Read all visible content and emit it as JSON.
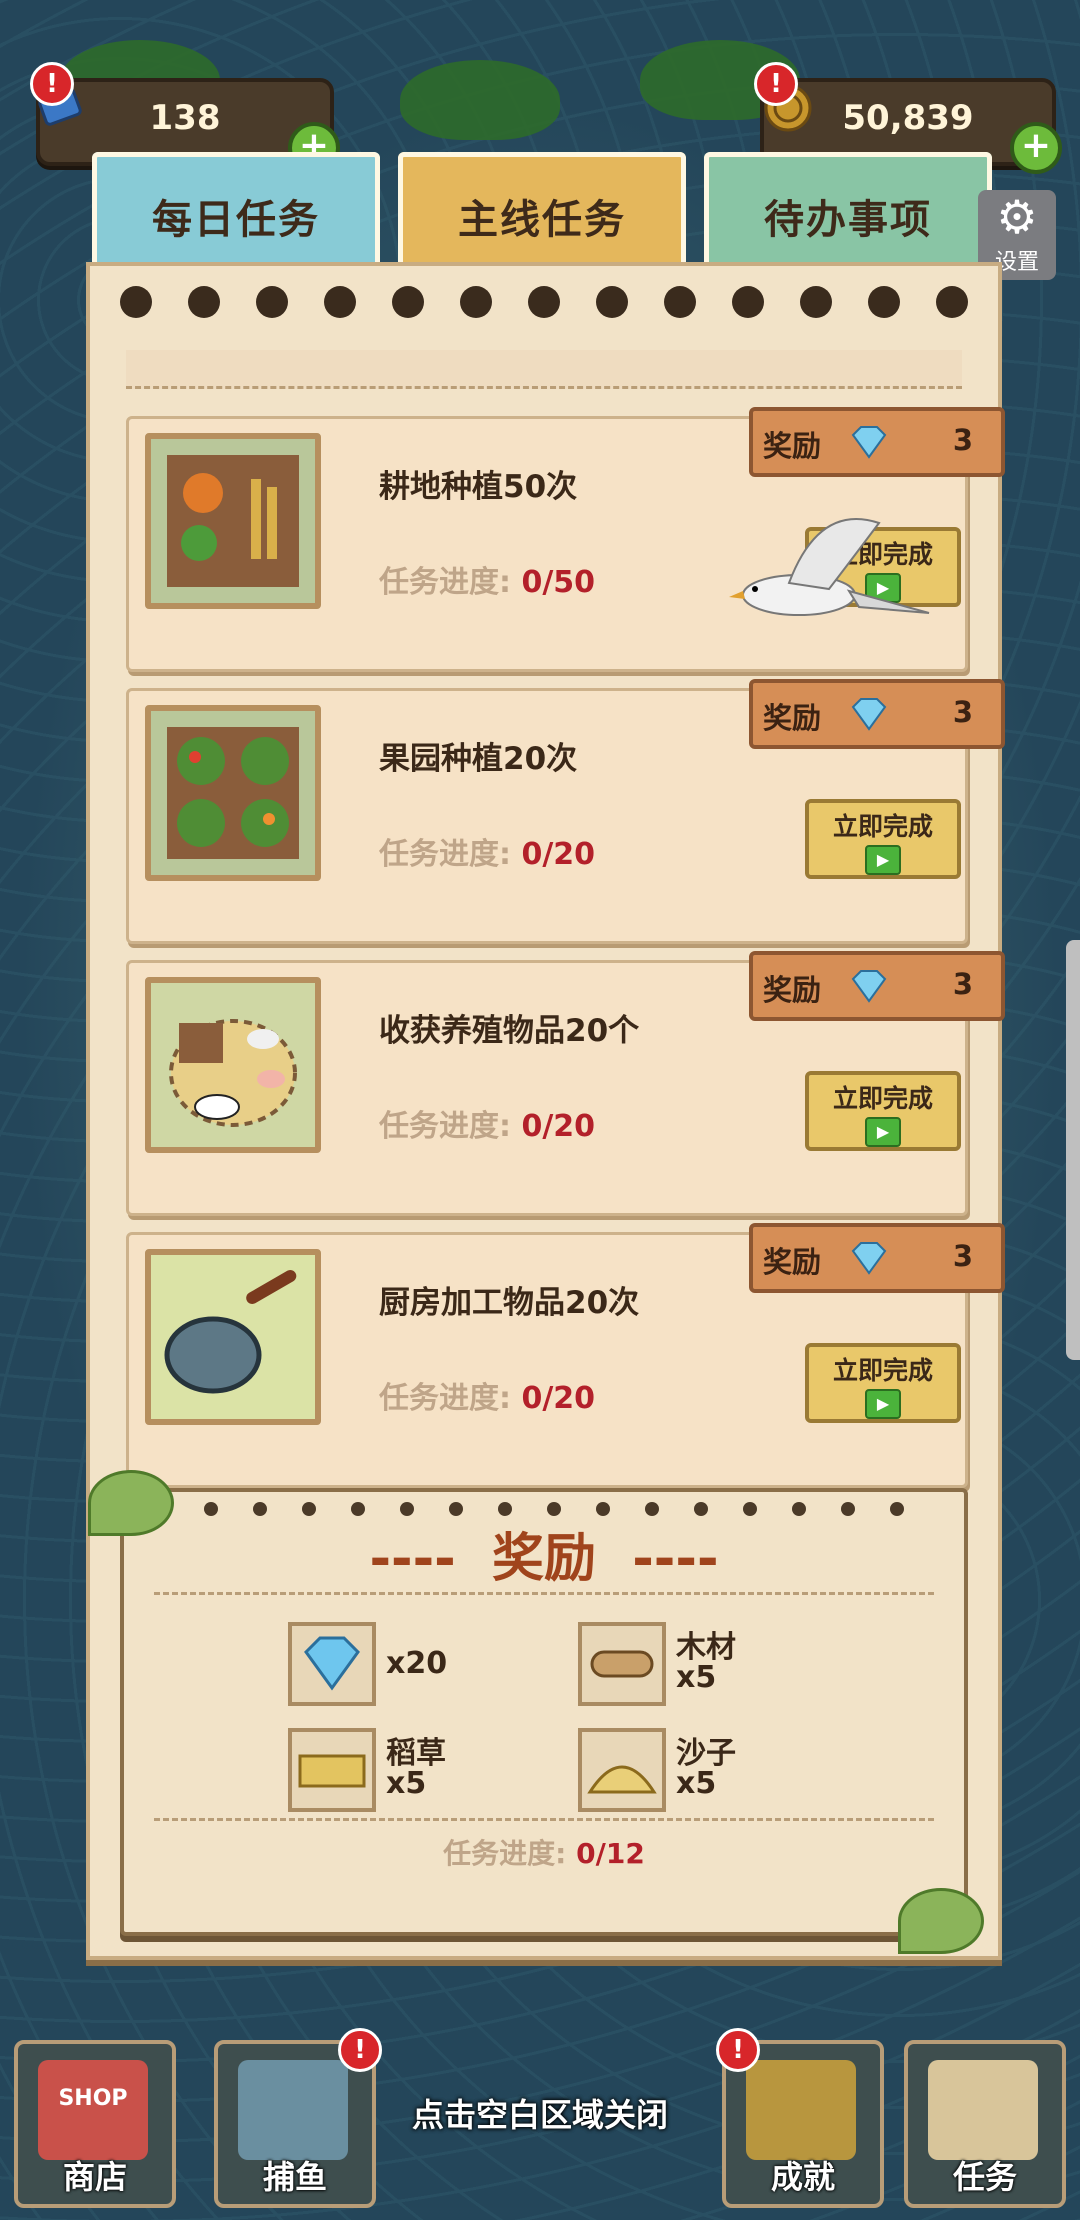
{
  "currency": {
    "gems": "138",
    "coins": "50,839"
  },
  "tabs": [
    {
      "label": "每日任务"
    },
    {
      "label": "主线任务"
    },
    {
      "label": "待办事项"
    }
  ],
  "settings_label": "设置",
  "progress_label": "任务进度:",
  "reward_label": "奖励",
  "complete_label": "立即完成",
  "tasks": [
    {
      "title": "耕地种植50次",
      "progress": "0/50",
      "reward": "3"
    },
    {
      "title": "果园种植20次",
      "progress": "0/20",
      "reward": "3"
    },
    {
      "title": "收获养殖物品20个",
      "progress": "0/20",
      "reward": "3"
    },
    {
      "title": "厨房加工物品20次",
      "progress": "0/20",
      "reward": "3"
    }
  ],
  "reward_box": {
    "title": "奖励",
    "dash": "----",
    "items": [
      {
        "name": "",
        "qty": "x20",
        "icon": "gem-icon"
      },
      {
        "name": "木材",
        "qty": "x5",
        "icon": "wood-icon"
      },
      {
        "name": "稻草",
        "qty": "x5",
        "icon": "straw-icon"
      },
      {
        "name": "沙子",
        "qty": "x5",
        "icon": "sand-icon"
      }
    ],
    "progress_label": "任务进度:",
    "progress_value": "0/12"
  },
  "close_hint": "点击空白区域关闭",
  "nav": [
    {
      "label": "商店",
      "icon": "shop-icon",
      "shop_sign": "SHOP"
    },
    {
      "label": "捕鱼",
      "icon": "sailboat-icon"
    },
    {
      "label": "成就",
      "icon": "medal-icon"
    },
    {
      "label": "任务",
      "icon": "scroll-quill-icon"
    }
  ],
  "colors": {
    "accent_red": "#b3202a",
    "reward_title": "#a0441c"
  }
}
